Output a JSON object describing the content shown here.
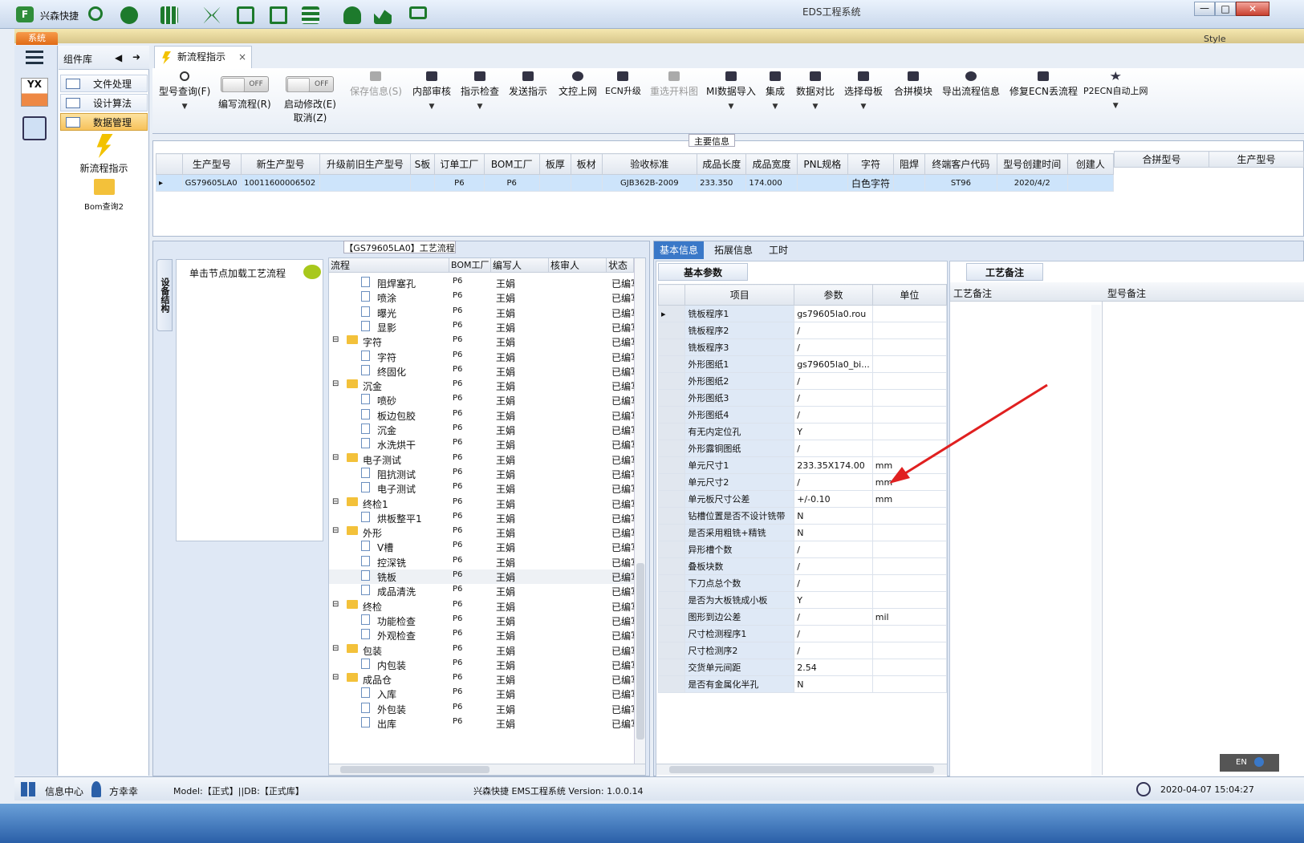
{
  "titlebar": {
    "app_name": "兴森快捷",
    "window_title": "EDS工程系统"
  },
  "menu": {
    "system_tab": "系统",
    "style_label": "Style"
  },
  "leftbar": {
    "logo_text": "YX"
  },
  "component_library": {
    "title": "组件库",
    "items": [
      {
        "label": "文件处理"
      },
      {
        "label": "设计算法"
      },
      {
        "label": "数据管理",
        "selected": true
      }
    ],
    "tools": [
      {
        "label": "新流程指示",
        "icon": "lightning-icon"
      },
      {
        "label": "Bom查询2",
        "icon": "folder-icon"
      }
    ]
  },
  "document_tab": {
    "label": "新流程指示",
    "close": "×"
  },
  "ribbon": {
    "buttons": [
      {
        "label": "型号查询(F)",
        "icon": "search-icon",
        "dropdown": true
      },
      {
        "label": "编写流程(R)",
        "toggle": "OFF"
      },
      {
        "label": "启动修改(E)",
        "sublabel": "取消(Z)",
        "toggle": "OFF"
      },
      {
        "label": "保存信息(S)",
        "icon": "check-icon",
        "disabled": true
      },
      {
        "label": "内部审核",
        "icon": "print-icon",
        "dropdown": true
      },
      {
        "label": "指示检查",
        "icon": "checklist-icon",
        "dropdown": true
      },
      {
        "label": "发送指示",
        "icon": "upload-icon"
      },
      {
        "label": "文控上网",
        "icon": "cloud-upload-icon"
      },
      {
        "label": "ECN升级",
        "icon": "binoculars-icon"
      },
      {
        "label": "重选开料图",
        "icon": "image-icon",
        "disabled": true
      },
      {
        "label": "MI数据导入",
        "icon": "import-icon",
        "dropdown": true
      },
      {
        "label": "集成",
        "icon": "download-icon",
        "dropdown": true
      },
      {
        "label": "数据对比",
        "icon": "compare-icon",
        "dropdown": true
      },
      {
        "label": "选择母板",
        "icon": "shuffle-icon",
        "dropdown": true
      },
      {
        "label": "合拼模块",
        "icon": "list-icon"
      },
      {
        "label": "导出流程信息",
        "icon": "smile-icon"
      },
      {
        "label": "修复ECN丢流程",
        "icon": "wrench-icon"
      },
      {
        "label": "P2ECN自动上网",
        "icon": "star-icon",
        "dropdown": true
      }
    ]
  },
  "main_info": {
    "label": "主要信息",
    "columns": [
      "生产型号",
      "新生产型号",
      "升级前旧生产型号",
      "S板",
      "订单工厂",
      "BOM工厂",
      "板厚",
      "板材",
      "验收标准",
      "成品长度",
      "成品宽度",
      "PNL规格",
      "字符",
      "阻焊",
      "终端客户代码",
      "型号创建时间",
      "创建人"
    ],
    "rows": [
      [
        "GS79605LA0",
        "10011600006502",
        "",
        "",
        "P6",
        "P6",
        "",
        "",
        "GJB362B-2009",
        "233.350",
        "174.000",
        "",
        "白色字符",
        "",
        "ST96",
        "2020/4/2",
        ""
      ]
    ],
    "side_columns": [
      "合拼型号",
      "生产型号"
    ]
  },
  "flow_panel": {
    "title": "【GS79605LA0】工艺流程",
    "vertical_tab": "设备结构",
    "hint": "单击节点加载工艺流程",
    "columns": [
      "流程",
      "BOM工厂",
      "编写人",
      "核审人",
      "状态"
    ],
    "rows": [
      {
        "name": "阻焊塞孔",
        "level": 2,
        "factory": "P6",
        "writer": "王娟",
        "status": "已编写"
      },
      {
        "name": "喷涂",
        "level": 2,
        "factory": "P6",
        "writer": "王娟",
        "status": "已编写"
      },
      {
        "name": "曝光",
        "level": 2,
        "factory": "P6",
        "writer": "王娟",
        "status": "已编写"
      },
      {
        "name": "显影",
        "level": 2,
        "factory": "P6",
        "writer": "王娟",
        "status": "已编写"
      },
      {
        "name": "字符",
        "level": 1,
        "factory": "P6",
        "writer": "王娟",
        "status": "已编写"
      },
      {
        "name": "字符",
        "level": 2,
        "factory": "P6",
        "writer": "王娟",
        "status": "已编写"
      },
      {
        "name": "终固化",
        "level": 2,
        "factory": "P6",
        "writer": "王娟",
        "status": "已编写"
      },
      {
        "name": "沉金",
        "level": 1,
        "factory": "P6",
        "writer": "王娟",
        "status": "已编写"
      },
      {
        "name": "喷砂",
        "level": 2,
        "factory": "P6",
        "writer": "王娟",
        "status": "已编写"
      },
      {
        "name": "板边包胶",
        "level": 2,
        "factory": "P6",
        "writer": "王娟",
        "status": "已编写"
      },
      {
        "name": "沉金",
        "level": 2,
        "factory": "P6",
        "writer": "王娟",
        "status": "已编写"
      },
      {
        "name": "水洗烘干",
        "level": 2,
        "factory": "P6",
        "writer": "王娟",
        "status": "已编写"
      },
      {
        "name": "电子测试",
        "level": 1,
        "factory": "P6",
        "writer": "王娟",
        "status": "已编写"
      },
      {
        "name": "阻抗测试",
        "level": 2,
        "factory": "P6",
        "writer": "王娟",
        "status": "已编写"
      },
      {
        "name": "电子测试",
        "level": 2,
        "factory": "P6",
        "writer": "王娟",
        "status": "已编写"
      },
      {
        "name": "终检1",
        "level": 1,
        "factory": "P6",
        "writer": "王娟",
        "status": "已编写"
      },
      {
        "name": "烘板整平1",
        "level": 2,
        "factory": "P6",
        "writer": "王娟",
        "status": "已编写"
      },
      {
        "name": "外形",
        "level": 1,
        "factory": "P6",
        "writer": "王娟",
        "status": "已编写"
      },
      {
        "name": "V槽",
        "level": 2,
        "factory": "P6",
        "writer": "王娟",
        "status": "已编写"
      },
      {
        "name": "控深铣",
        "level": 2,
        "factory": "P6",
        "writer": "王娟",
        "status": "已编写"
      },
      {
        "name": "铣板",
        "level": 2,
        "factory": "P6",
        "writer": "王娟",
        "status": "已编写",
        "selected": true
      },
      {
        "name": "成品清洗",
        "level": 2,
        "factory": "P6",
        "writer": "王娟",
        "status": "已编写"
      },
      {
        "name": "终检",
        "level": 1,
        "factory": "P6",
        "writer": "王娟",
        "status": "已编写"
      },
      {
        "name": "功能检查",
        "level": 2,
        "factory": "P6",
        "writer": "王娟",
        "status": "已编写"
      },
      {
        "name": "外观检查",
        "level": 2,
        "factory": "P6",
        "writer": "王娟",
        "status": "已编写"
      },
      {
        "name": "包装",
        "level": 1,
        "factory": "P6",
        "writer": "王娟",
        "status": "已编写"
      },
      {
        "name": "内包装",
        "level": 2,
        "factory": "P6",
        "writer": "王娟",
        "status": "已编写"
      },
      {
        "name": "成品仓",
        "level": 1,
        "factory": "P6",
        "writer": "王娟",
        "status": "已编写"
      },
      {
        "name": "入库",
        "level": 2,
        "factory": "P6",
        "writer": "王娟",
        "status": "已编写"
      },
      {
        "name": "外包装",
        "level": 2,
        "factory": "P6",
        "writer": "王娟",
        "status": "已编写"
      },
      {
        "name": "出库",
        "level": 2,
        "factory": "P6",
        "writer": "王娟",
        "status": "已编写"
      }
    ]
  },
  "info_panel": {
    "tabs": [
      {
        "label": "基本信息",
        "active": true
      },
      {
        "label": "拓展信息"
      },
      {
        "label": "工时"
      }
    ],
    "param_tab": "基本参数",
    "param_columns": [
      "项目",
      "参数",
      "单位"
    ],
    "params": [
      [
        "铣板程序1",
        "gs79605la0.rou",
        ""
      ],
      [
        "铣板程序2",
        "/",
        ""
      ],
      [
        "铣板程序3",
        "/",
        ""
      ],
      [
        "外形图纸1",
        "gs79605la0_bi...",
        ""
      ],
      [
        "外形图纸2",
        "/",
        ""
      ],
      [
        "外形图纸3",
        "/",
        ""
      ],
      [
        "外形图纸4",
        "/",
        ""
      ],
      [
        "有无内定位孔",
        "Y",
        ""
      ],
      [
        "外形露铜图纸",
        "/",
        ""
      ],
      [
        "单元尺寸1",
        "233.35X174.00",
        "mm"
      ],
      [
        "单元尺寸2",
        "/",
        "mm"
      ],
      [
        "单元板尺寸公差",
        "+/-0.10",
        "mm"
      ],
      [
        "钻槽位置是否不设计铣带",
        "N",
        ""
      ],
      [
        "是否采用粗铣+精铣",
        "N",
        ""
      ],
      [
        "异形槽个数",
        "/",
        ""
      ],
      [
        "叠板块数",
        "/",
        ""
      ],
      [
        "下刀点总个数",
        "/",
        ""
      ],
      [
        "是否为大板铣成小板",
        "Y",
        ""
      ],
      [
        "图形到边公差",
        "/",
        "mil"
      ],
      [
        "尺寸检测程序1",
        "/",
        ""
      ],
      [
        "尺寸检测序2",
        "/",
        ""
      ],
      [
        "交货单元间距",
        "2.54",
        ""
      ],
      [
        "是否有金属化半孔",
        "N",
        ""
      ]
    ],
    "remark_tab": "工艺备注",
    "remark_columns": [
      "工艺备注",
      "型号备注"
    ]
  },
  "statusbar": {
    "info_center": "信息中心",
    "user": "方幸幸",
    "model_db": "Model:【正式】||DB:【正式库】",
    "system_version": "兴森快捷  EMS工程系统  Version: 1.0.0.14",
    "datetime": "2020-04-07 15:04:27"
  },
  "ime": {
    "label": "EN"
  },
  "colors": {
    "accent": "#3a78c8",
    "selected_row": "#cde4fb",
    "arrow": "#e02020"
  }
}
